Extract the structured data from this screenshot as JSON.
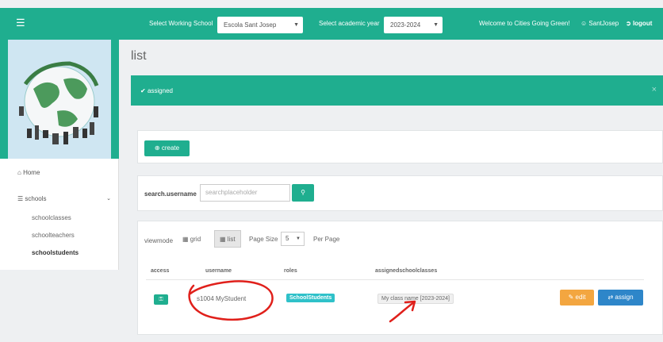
{
  "topbar": {
    "menu_icon": "hamburger-icon",
    "working_school_label": "Select Working School",
    "working_school_value": "Escola Sant Josep",
    "academic_year_label": "Select academic year",
    "academic_year_value": "2023-2024",
    "welcome_text": "Welcome to Cities Going Green!",
    "user_name": "SantJosep",
    "logout_label": "logout",
    "accent_color": "#1fae8f"
  },
  "sidebar": {
    "home_label": "Home",
    "schools_label": "schools",
    "sub_items": [
      "schoolclasses",
      "schoolteachers",
      "schoolstudents"
    ],
    "active_item": "schoolstudents"
  },
  "main": {
    "page_title": "list",
    "alert_text": "assigned",
    "alert_close": "×",
    "create_label": "create",
    "search_label": "search.username",
    "search_placeholder": "searchplaceholder",
    "viewmode_label": "viewmode",
    "grid_label": "grid",
    "list_label": "list",
    "page_size_label": "Page Size",
    "page_size_value": "5",
    "per_page_label": "Per Page",
    "columns": [
      "access",
      "username",
      "roles",
      "assignedschoolclasses"
    ],
    "rows": [
      {
        "username": "s1004 MyStudent",
        "role": "SchoolStudents",
        "assigned_class": "My class name [2023-2024]",
        "edit_label": "edit",
        "assign_label": "assign"
      }
    ]
  },
  "annotations": {
    "circle_color": "#e0201b"
  }
}
